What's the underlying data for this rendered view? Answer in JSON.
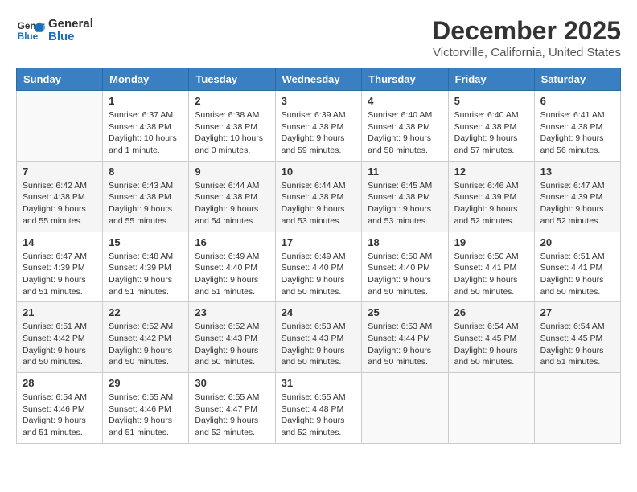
{
  "header": {
    "logo_line1": "General",
    "logo_line2": "Blue",
    "month": "December 2025",
    "location": "Victorville, California, United States"
  },
  "weekdays": [
    "Sunday",
    "Monday",
    "Tuesday",
    "Wednesday",
    "Thursday",
    "Friday",
    "Saturday"
  ],
  "weeks": [
    [
      {
        "day": "",
        "info": ""
      },
      {
        "day": "1",
        "info": "Sunrise: 6:37 AM\nSunset: 4:38 PM\nDaylight: 10 hours\nand 1 minute."
      },
      {
        "day": "2",
        "info": "Sunrise: 6:38 AM\nSunset: 4:38 PM\nDaylight: 10 hours\nand 0 minutes."
      },
      {
        "day": "3",
        "info": "Sunrise: 6:39 AM\nSunset: 4:38 PM\nDaylight: 9 hours\nand 59 minutes."
      },
      {
        "day": "4",
        "info": "Sunrise: 6:40 AM\nSunset: 4:38 PM\nDaylight: 9 hours\nand 58 minutes."
      },
      {
        "day": "5",
        "info": "Sunrise: 6:40 AM\nSunset: 4:38 PM\nDaylight: 9 hours\nand 57 minutes."
      },
      {
        "day": "6",
        "info": "Sunrise: 6:41 AM\nSunset: 4:38 PM\nDaylight: 9 hours\nand 56 minutes."
      }
    ],
    [
      {
        "day": "7",
        "info": "Sunrise: 6:42 AM\nSunset: 4:38 PM\nDaylight: 9 hours\nand 55 minutes."
      },
      {
        "day": "8",
        "info": "Sunrise: 6:43 AM\nSunset: 4:38 PM\nDaylight: 9 hours\nand 55 minutes."
      },
      {
        "day": "9",
        "info": "Sunrise: 6:44 AM\nSunset: 4:38 PM\nDaylight: 9 hours\nand 54 minutes."
      },
      {
        "day": "10",
        "info": "Sunrise: 6:44 AM\nSunset: 4:38 PM\nDaylight: 9 hours\nand 53 minutes."
      },
      {
        "day": "11",
        "info": "Sunrise: 6:45 AM\nSunset: 4:38 PM\nDaylight: 9 hours\nand 53 minutes."
      },
      {
        "day": "12",
        "info": "Sunrise: 6:46 AM\nSunset: 4:39 PM\nDaylight: 9 hours\nand 52 minutes."
      },
      {
        "day": "13",
        "info": "Sunrise: 6:47 AM\nSunset: 4:39 PM\nDaylight: 9 hours\nand 52 minutes."
      }
    ],
    [
      {
        "day": "14",
        "info": "Sunrise: 6:47 AM\nSunset: 4:39 PM\nDaylight: 9 hours\nand 51 minutes."
      },
      {
        "day": "15",
        "info": "Sunrise: 6:48 AM\nSunset: 4:39 PM\nDaylight: 9 hours\nand 51 minutes."
      },
      {
        "day": "16",
        "info": "Sunrise: 6:49 AM\nSunset: 4:40 PM\nDaylight: 9 hours\nand 51 minutes."
      },
      {
        "day": "17",
        "info": "Sunrise: 6:49 AM\nSunset: 4:40 PM\nDaylight: 9 hours\nand 50 minutes."
      },
      {
        "day": "18",
        "info": "Sunrise: 6:50 AM\nSunset: 4:40 PM\nDaylight: 9 hours\nand 50 minutes."
      },
      {
        "day": "19",
        "info": "Sunrise: 6:50 AM\nSunset: 4:41 PM\nDaylight: 9 hours\nand 50 minutes."
      },
      {
        "day": "20",
        "info": "Sunrise: 6:51 AM\nSunset: 4:41 PM\nDaylight: 9 hours\nand 50 minutes."
      }
    ],
    [
      {
        "day": "21",
        "info": "Sunrise: 6:51 AM\nSunset: 4:42 PM\nDaylight: 9 hours\nand 50 minutes."
      },
      {
        "day": "22",
        "info": "Sunrise: 6:52 AM\nSunset: 4:42 PM\nDaylight: 9 hours\nand 50 minutes."
      },
      {
        "day": "23",
        "info": "Sunrise: 6:52 AM\nSunset: 4:43 PM\nDaylight: 9 hours\nand 50 minutes."
      },
      {
        "day": "24",
        "info": "Sunrise: 6:53 AM\nSunset: 4:43 PM\nDaylight: 9 hours\nand 50 minutes."
      },
      {
        "day": "25",
        "info": "Sunrise: 6:53 AM\nSunset: 4:44 PM\nDaylight: 9 hours\nand 50 minutes."
      },
      {
        "day": "26",
        "info": "Sunrise: 6:54 AM\nSunset: 4:45 PM\nDaylight: 9 hours\nand 50 minutes."
      },
      {
        "day": "27",
        "info": "Sunrise: 6:54 AM\nSunset: 4:45 PM\nDaylight: 9 hours\nand 51 minutes."
      }
    ],
    [
      {
        "day": "28",
        "info": "Sunrise: 6:54 AM\nSunset: 4:46 PM\nDaylight: 9 hours\nand 51 minutes."
      },
      {
        "day": "29",
        "info": "Sunrise: 6:55 AM\nSunset: 4:46 PM\nDaylight: 9 hours\nand 51 minutes."
      },
      {
        "day": "30",
        "info": "Sunrise: 6:55 AM\nSunset: 4:47 PM\nDaylight: 9 hours\nand 52 minutes."
      },
      {
        "day": "31",
        "info": "Sunrise: 6:55 AM\nSunset: 4:48 PM\nDaylight: 9 hours\nand 52 minutes."
      },
      {
        "day": "",
        "info": ""
      },
      {
        "day": "",
        "info": ""
      },
      {
        "day": "",
        "info": ""
      }
    ]
  ]
}
